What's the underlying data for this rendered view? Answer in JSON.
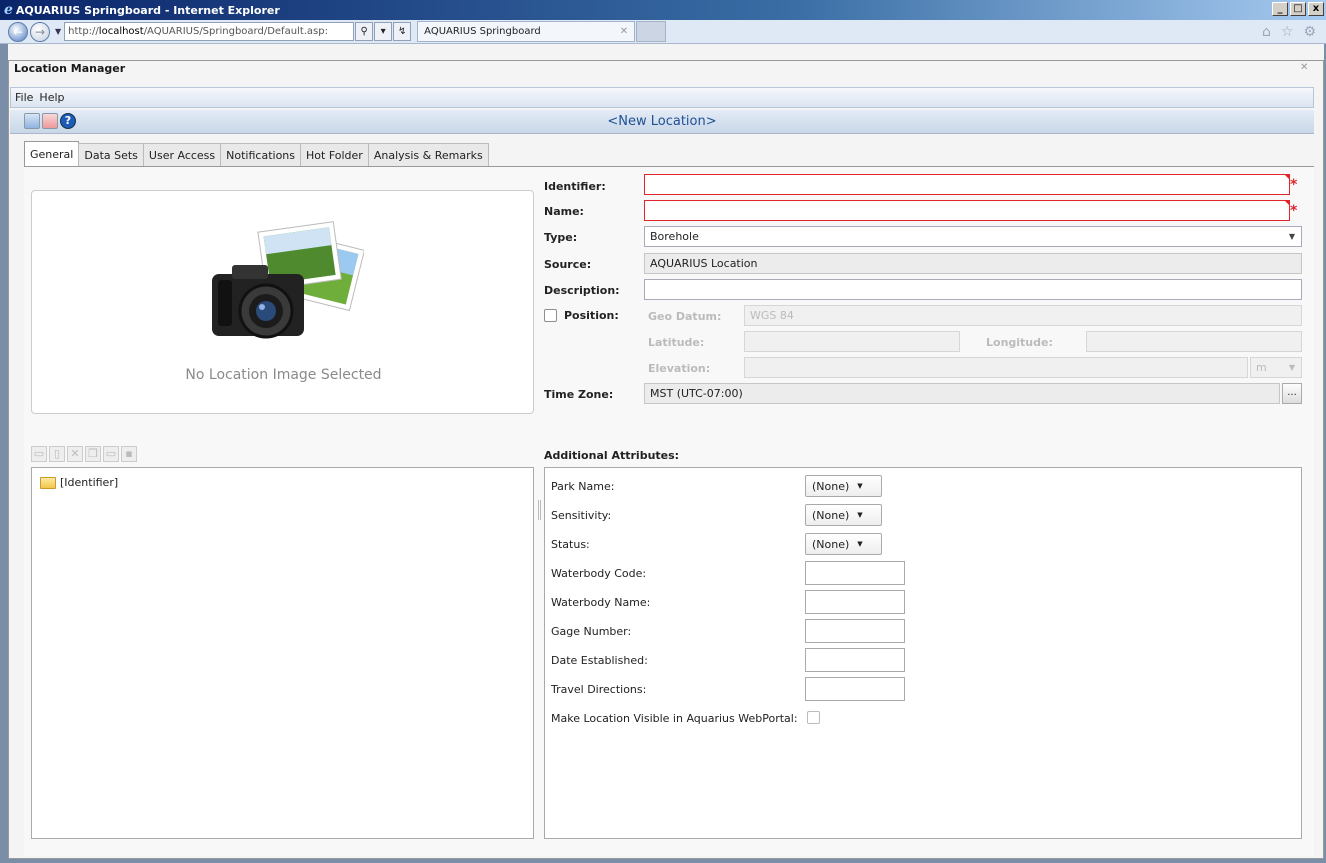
{
  "browser": {
    "title": "AQUARIUS Springboard - Internet Explorer",
    "address_prefix": "http://",
    "address_host": "localhost",
    "address_path": "/AQUARIUS/Springboard/Default.asp:",
    "tab_label": "AQUARIUS Springboard",
    "window_buttons": [
      "_",
      "□",
      "x"
    ]
  },
  "app": {
    "title": "Location Manager",
    "menu": [
      "File",
      "Help"
    ],
    "header_title": "<New Location>"
  },
  "tabs": [
    "General",
    "Data Sets",
    "User Access",
    "Notifications",
    "Hot Folder",
    "Analysis & Remarks"
  ],
  "image_panel": {
    "empty_text": "No Location Image Selected"
  },
  "tree": {
    "root_label": "[Identifier]"
  },
  "form": {
    "identifier_label": "Identifier:",
    "identifier_value": "",
    "name_label": "Name:",
    "name_value": "",
    "type_label": "Type:",
    "type_value": "Borehole",
    "source_label": "Source:",
    "source_value": "AQUARIUS Location",
    "description_label": "Description:",
    "description_value": "",
    "position_label": "Position:",
    "geo_datum_label": "Geo Datum:",
    "geo_datum_value": "WGS 84",
    "latitude_label": "Latitude:",
    "longitude_label": "Longitude:",
    "elevation_label": "Elevation:",
    "elevation_unit": "m",
    "timezone_label": "Time Zone:",
    "timezone_value": "MST (UTC-07:00)",
    "timezone_button": "...",
    "required_marker": "*"
  },
  "attributes": {
    "heading": "Additional Attributes:",
    "park_name_label": "Park Name:",
    "park_name_value": "(None)",
    "sensitivity_label": "Sensitivity:",
    "sensitivity_value": "(None)",
    "status_label": "Status:",
    "status_value": "(None)",
    "waterbody_code_label": "Waterbody Code:",
    "waterbody_name_label": "Waterbody Name:",
    "gage_number_label": "Gage Number:",
    "date_established_label": "Date Established:",
    "travel_directions_label": "Travel Directions:",
    "webportal_label": "Make Location Visible in Aquarius WebPortal:"
  }
}
